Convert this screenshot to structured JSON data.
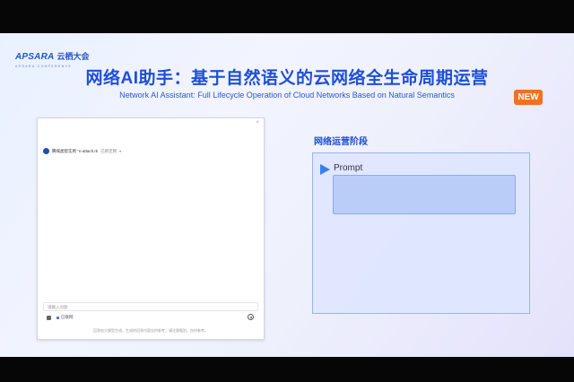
{
  "logo": {
    "brand": "APSARA",
    "brand_cn": "云栖大会",
    "tagline": "APSARA CONFERENCE"
  },
  "header": {
    "title_cn": "网络AI助手：基于自然语义的云网络全生命周期运营",
    "title_en": "Network AI Assistant: Full Lifecycle Operation of Cloud Networks Based on Natural Semantics",
    "badge": "NEW"
  },
  "chat": {
    "close": "×",
    "header_name": "腾域类智实例 \"n-attach.rk",
    "header_tag": "已绑定网",
    "input_placeholder": "请输入问题",
    "tool_label": "已联网",
    "footer": "回答由大模型生成，生成的回答内容仅供参考，请注意甄别，仅供参考。"
  },
  "stage": {
    "title": "网络运营阶段",
    "prompt_label": "Prompt"
  },
  "colors": {
    "accent": "#1e4fd6",
    "badge": "#f37020",
    "prompt_arrow": "#3b7ef0"
  }
}
